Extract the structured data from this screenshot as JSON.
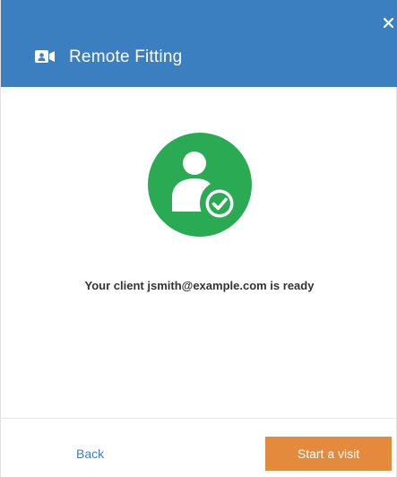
{
  "header": {
    "title": "Remote Fitting",
    "icon": "video-camera-icon",
    "close_icon": "close-icon",
    "background_color": "#3c7fc1"
  },
  "content": {
    "avatar_icon": "user-check-icon",
    "avatar_color": "#2aab53",
    "message": "Your client jsmith@example.com is ready"
  },
  "footer": {
    "back_label": "Back",
    "start_label": "Start a visit",
    "start_color": "#e38a3d"
  }
}
